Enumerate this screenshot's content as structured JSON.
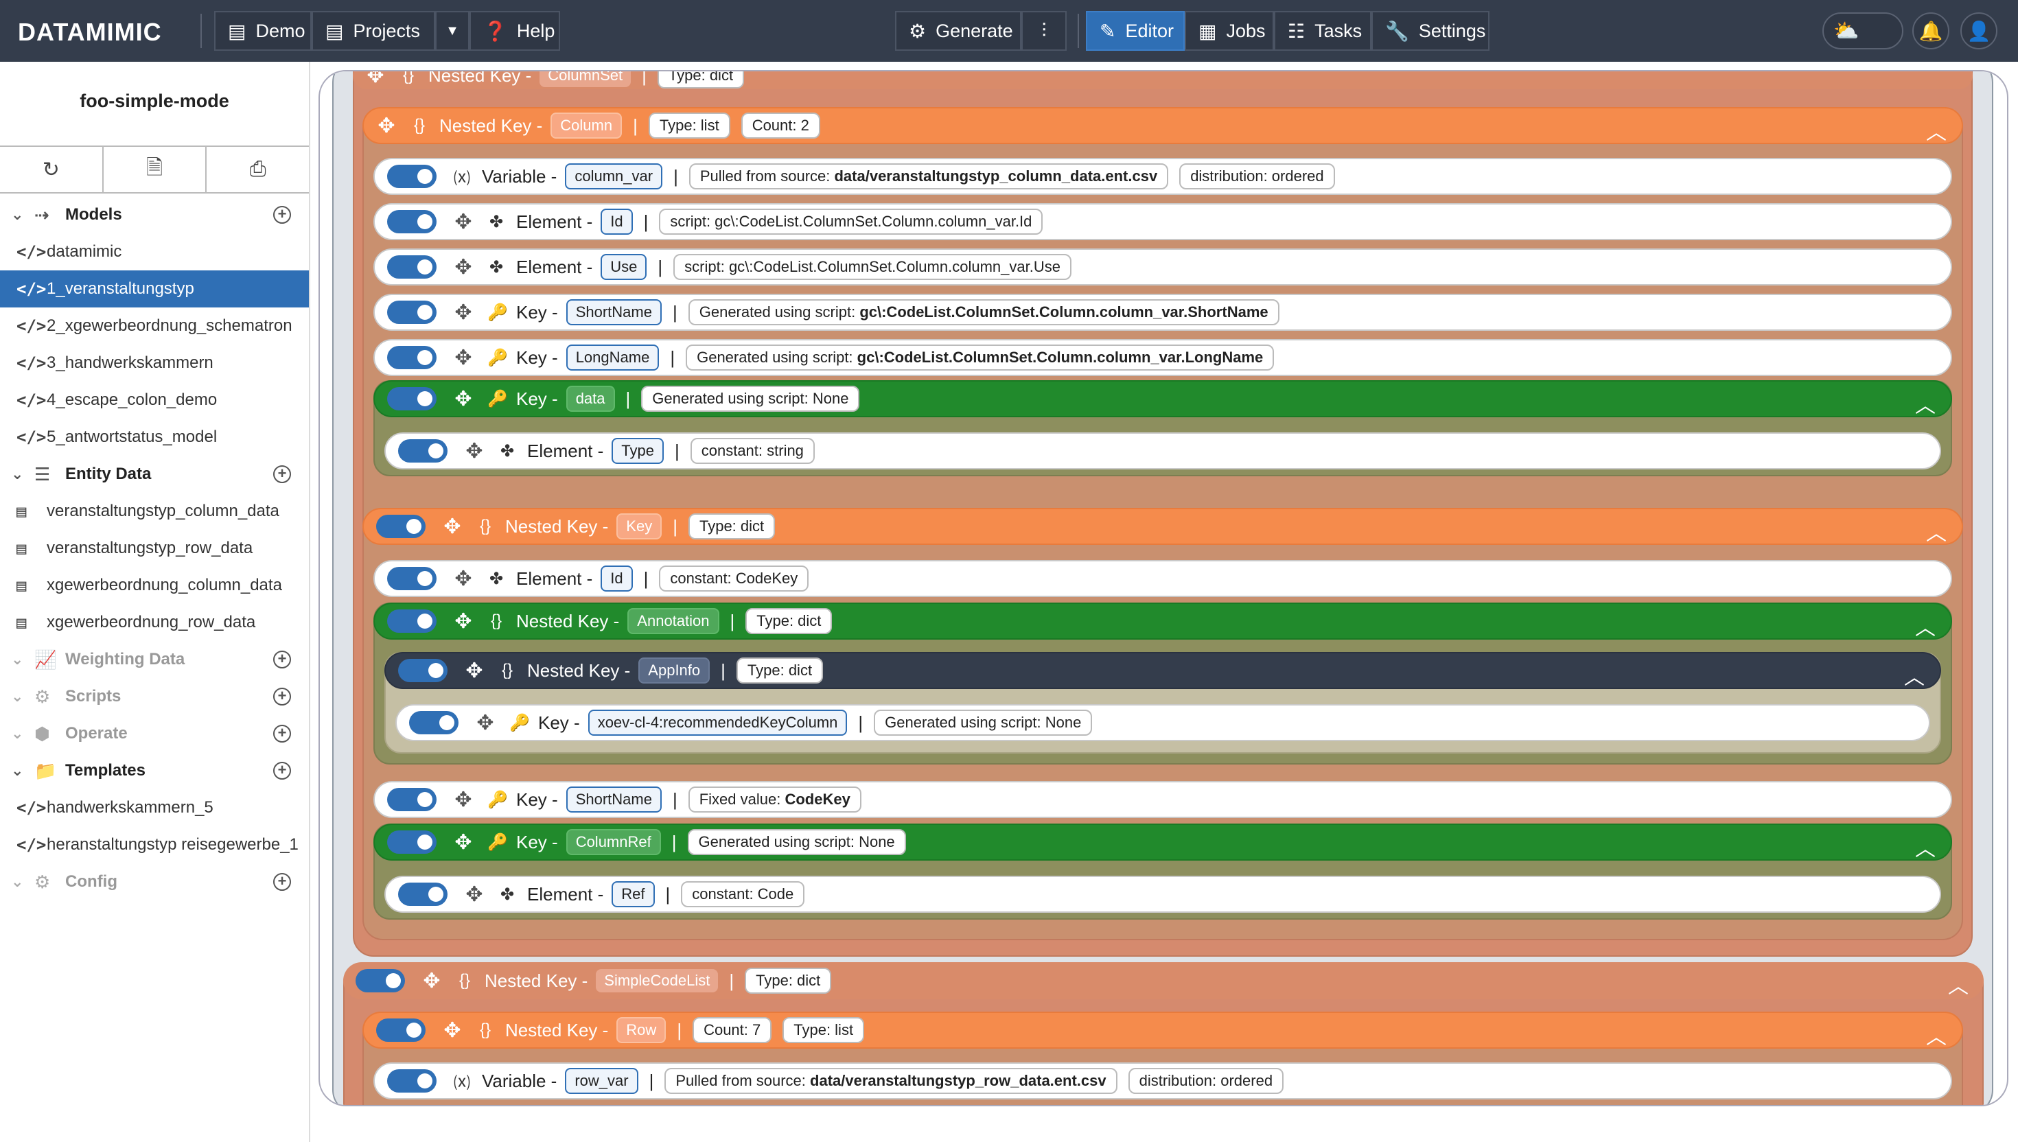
{
  "brand": "DATAMIMIC",
  "nav": {
    "demo": "Demo",
    "projects": "Projects",
    "help": "Help",
    "generate": "Generate",
    "editor": "Editor",
    "jobs": "Jobs",
    "tasks": "Tasks",
    "settings": "Settings"
  },
  "sidebar": {
    "project_title": "foo-simple-mode",
    "sections": {
      "models": "Models",
      "entity_data": "Entity Data",
      "weighting_data": "Weighting Data",
      "scripts": "Scripts",
      "operate": "Operate",
      "templates": "Templates",
      "config": "Config"
    },
    "models": [
      "datamimic",
      "1_veranstaltungstyp",
      "2_xgewerbeordnung_schematron",
      "3_handwerkskammern",
      "4_escape_colon_demo",
      "5_antwortstatus_model"
    ],
    "entity_data": [
      "veranstaltungstyp_column_data",
      "veranstaltungstyp_row_data",
      "xgewerbeordnung_column_data",
      "xgewerbeordnung_row_data"
    ],
    "templates": [
      "handwerkskammern_5",
      "heranstaltungstyp reisegewerbe_1"
    ],
    "selected": "1_veranstaltungstyp"
  },
  "editor": {
    "top_partial": {
      "title": "Nested Key -",
      "name": "ColumnSet",
      "info": "Type: dict"
    },
    "column_block": {
      "title": "Nested Key -",
      "name": "Column",
      "type": "Type: list",
      "count": "Count: 2"
    },
    "column_var": {
      "title": "Variable -",
      "name": "column_var",
      "source_label": "Pulled from source: ",
      "source": "data/veranstaltungstyp_column_data.ent.csv",
      "dist": "distribution: ordered"
    },
    "el_id": {
      "title": "Element -",
      "name": "Id",
      "info": "script: gc\\:CodeList.ColumnSet.Column.column_var.Id"
    },
    "el_use": {
      "title": "Element -",
      "name": "Use",
      "info": "script: gc\\:CodeList.ColumnSet.Column.column_var.Use"
    },
    "key_shortname": {
      "title": "Key -",
      "name": "ShortName",
      "info_label": "Generated using script: ",
      "info": "gc\\:CodeList.ColumnSet.Column.column_var.ShortName"
    },
    "key_longname": {
      "title": "Key -",
      "name": "LongName",
      "info_label": "Generated using script: ",
      "info": "gc\\:CodeList.ColumnSet.Column.column_var.LongName"
    },
    "key_data": {
      "title": "Key -",
      "name": "data",
      "info": "Generated using script: None"
    },
    "el_type": {
      "title": "Element -",
      "name": "Type",
      "info": "constant: string"
    },
    "key_block": {
      "title": "Nested Key -",
      "name": "Key",
      "info": "Type: dict"
    },
    "key_el_id": {
      "title": "Element -",
      "name": "Id",
      "info": "constant: CodeKey"
    },
    "annotation": {
      "title": "Nested Key -",
      "name": "Annotation",
      "info": "Type: dict"
    },
    "appinfo": {
      "title": "Nested Key -",
      "name": "AppInfo",
      "info": "Type: dict"
    },
    "xoev_key": {
      "title": "Key -",
      "name": "xoev-cl-4:recommendedKeyColumn",
      "info": "Generated using script: None"
    },
    "key_shortname2": {
      "title": "Key -",
      "name": "ShortName",
      "info_label": "Fixed value: ",
      "info": "CodeKey"
    },
    "columnref": {
      "title": "Key -",
      "name": "ColumnRef",
      "info": "Generated using script: None"
    },
    "el_ref": {
      "title": "Element -",
      "name": "Ref",
      "info": "constant: Code"
    },
    "simplecodelist": {
      "title": "Nested Key -",
      "name": "SimpleCodeList",
      "info": "Type: dict"
    },
    "row_block": {
      "title": "Nested Key -",
      "name": "Row",
      "count": "Count: 7",
      "type": "Type: list"
    },
    "row_var": {
      "title": "Variable -",
      "name": "row_var",
      "source_label": "Pulled from source: ",
      "source": "data/veranstaltungstyp_row_data.ent.csv",
      "dist": "distribution: ordered"
    }
  }
}
